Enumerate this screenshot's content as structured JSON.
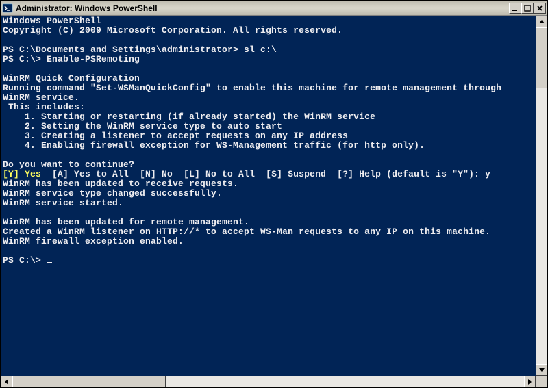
{
  "window": {
    "title": "Administrator: Windows PowerShell"
  },
  "console": {
    "header1": "Windows PowerShell",
    "header2": "Copyright (C) 2009 Microsoft Corporation. All rights reserved.",
    "blank": "",
    "prompt1": "PS C:\\Documents and Settings\\administrator> sl c:\\",
    "prompt2": "PS C:\\> Enable-PSRemoting",
    "cfg_title": "WinRM Quick Configuration",
    "cfg_line1": "Running command \"Set-WSManQuickConfig\" to enable this machine for remote management through",
    "cfg_line2": "WinRM service.",
    "cfg_includes": " This includes:",
    "cfg_item1": "    1. Starting or restarting (if already started) the WinRM service",
    "cfg_item2": "    2. Setting the WinRM service type to auto start",
    "cfg_item3": "    3. Creating a listener to accept requests on any IP address",
    "cfg_item4": "    4. Enabling firewall exception for WS-Management traffic (for http only).",
    "confirm_q": "Do you want to continue?",
    "choice_yes": "[Y] Yes",
    "choice_rest": "  [A] Yes to All  [N] No  [L] No to All  [S] Suspend  [?] Help (default is \"Y\"): y",
    "result1": "WinRM has been updated to receive requests.",
    "result2": "WinRM service type changed successfully.",
    "result3": "WinRM service started.",
    "result4": "WinRM has been updated for remote management.",
    "result5": "Created a WinRM listener on HTTP://* to accept WS-Man requests to any IP on this machine.",
    "result6": "WinRM firewall exception enabled.",
    "final_prompt": "PS C:\\> "
  },
  "scrollbars": {
    "v_thumb_ratio": 0.18,
    "h_thumb_ratio": 0.3
  }
}
